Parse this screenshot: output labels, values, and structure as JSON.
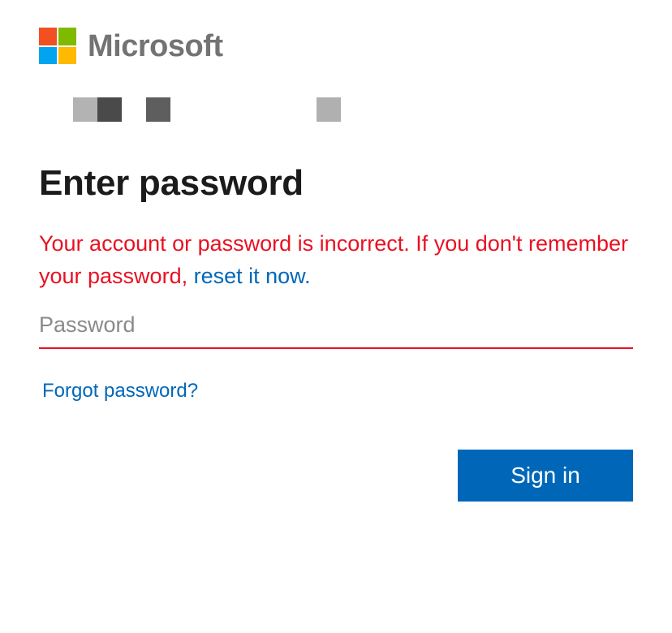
{
  "brand": {
    "name": "Microsoft",
    "logo_colors": [
      "#f25022",
      "#7fba00",
      "#00a4ef",
      "#ffb900"
    ]
  },
  "account": {
    "identifier_icon": "redacted-blocks"
  },
  "page": {
    "title": "Enter password"
  },
  "error": {
    "message": "Your account or password is incorrect. If you don't remember your password,",
    "link_text": "reset it now."
  },
  "password_field": {
    "placeholder": "Password",
    "value": ""
  },
  "links": {
    "forgot_password": "Forgot password?"
  },
  "actions": {
    "sign_in": "Sign in"
  },
  "colors": {
    "accent": "#0067b8",
    "error": "#e81123",
    "text": "#1b1b1b",
    "logo_text": "#737373"
  }
}
